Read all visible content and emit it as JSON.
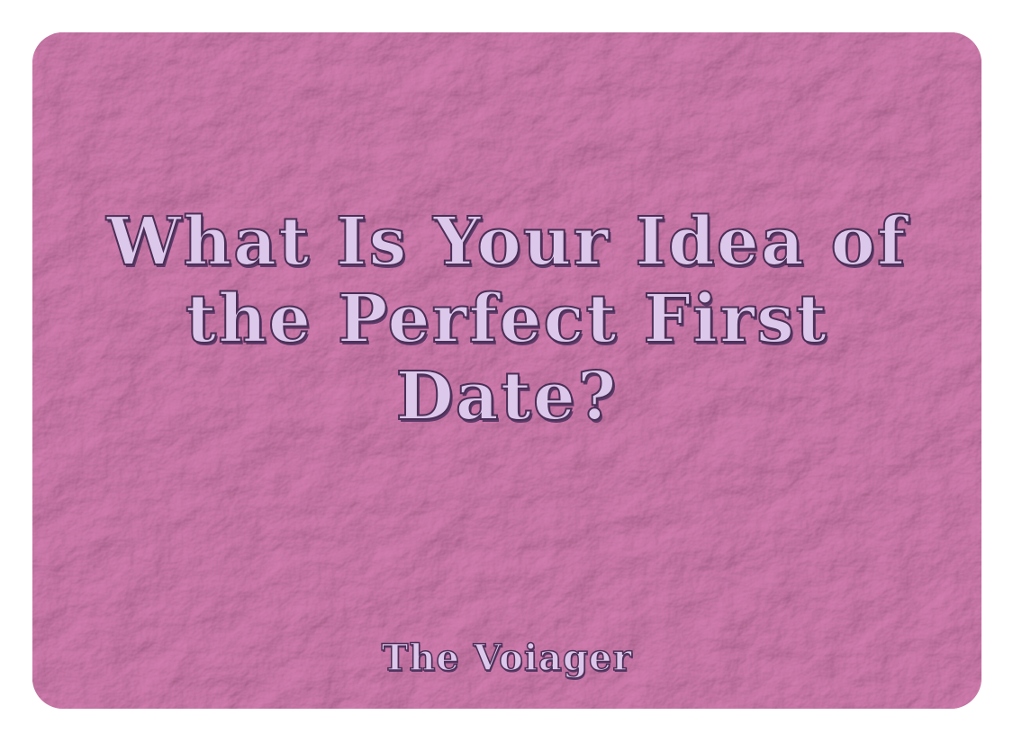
{
  "card": {
    "title": "What Is Your Idea of the Perfect First Date?",
    "brand": "The Voiager"
  },
  "colors": {
    "background": "#c06f9f",
    "text_fill": "#dcc8ea",
    "text_outline": "#4b2f57"
  }
}
